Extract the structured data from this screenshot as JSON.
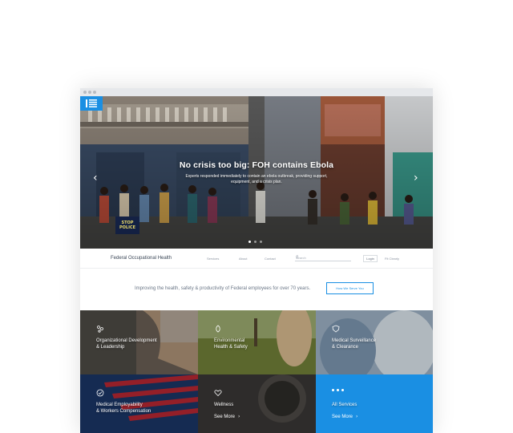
{
  "window": {
    "title_dots": 3
  },
  "hero": {
    "title": "No crisis too big: FOH contains Ebola",
    "subtitle": "Experts responded immediately to contain an ebola outbreak, providing support, equipment, and a crisis plan.",
    "sign_text": "STOP POLICE",
    "slides": 3,
    "active_slide": 1
  },
  "nav": {
    "brand": "Federal Occupational Health",
    "links": [
      "Services",
      "About",
      "Contact"
    ],
    "search_placeholder": "Search",
    "login": "Login",
    "signup": "Fit Clearly"
  },
  "tagline": {
    "text": "Improving the health, safety & productivity of Federal employees for over 70 years.",
    "button": "How We Serve You"
  },
  "tiles": [
    {
      "label": "Organizational Development\n& Leadership",
      "icon": "people-icon"
    },
    {
      "label": "Environmental\nHealth & Safety",
      "icon": "leaf-icon"
    },
    {
      "label": "Medical Surveillance\n& Clearance",
      "icon": "shield-icon"
    },
    {
      "label": "Medical Employability\n& Workers Compensation",
      "icon": "check-circle-icon"
    },
    {
      "label": "Wellness",
      "more": "See More",
      "icon": "heart-icon"
    },
    {
      "label": "All Services",
      "more": "See More",
      "icon": "dots-icon"
    }
  ],
  "colors": {
    "accent": "#1a8fe3"
  }
}
